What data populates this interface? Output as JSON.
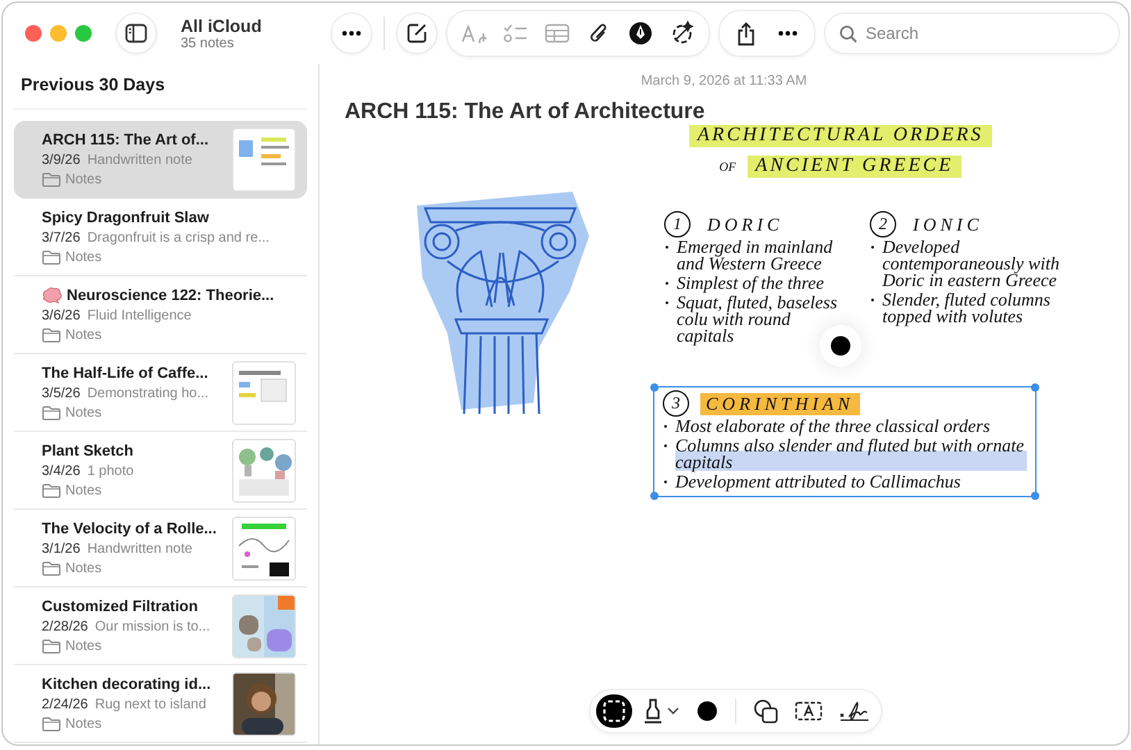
{
  "window": {
    "folder": "All iCloud",
    "note_count": "35 notes"
  },
  "search": {
    "placeholder": "Search"
  },
  "sidebar": {
    "section": "Previous 30 Days",
    "notes": [
      {
        "title": "ARCH 115: The Art of...",
        "date": "3/9/26",
        "snippet": "Handwritten note",
        "folder": "Notes",
        "kind": "thumbnail",
        "selected": true
      },
      {
        "title": "Spicy Dragonfruit Slaw",
        "date": "3/7/26",
        "snippet": "Dragonfruit is a crisp and re...",
        "folder": "Notes",
        "kind": "text",
        "selected": false
      },
      {
        "title": "Neuroscience 122: Theorie...",
        "date": "3/6/26",
        "snippet": "Fluid Intelligence",
        "folder": "Notes",
        "kind": "emoji",
        "selected": false
      },
      {
        "title": "The Half-Life of Caffe...",
        "date": "3/5/26",
        "snippet": "Demonstrating ho...",
        "folder": "Notes",
        "kind": "thumbnail",
        "selected": false
      },
      {
        "title": "Plant Sketch",
        "date": "3/4/26",
        "snippet": "1 photo",
        "folder": "Notes",
        "kind": "thumbnail",
        "selected": false
      },
      {
        "title": "The Velocity of a Rolle...",
        "date": "3/1/26",
        "snippet": "Handwritten note",
        "folder": "Notes",
        "kind": "thumbnail",
        "selected": false
      },
      {
        "title": "Customized Filtration",
        "date": "2/28/26",
        "snippet": "Our mission is to...",
        "folder": "Notes",
        "kind": "thumbnail",
        "selected": false
      },
      {
        "title": "Kitchen decorating id...",
        "date": "2/24/26",
        "snippet": "Rug next to island",
        "folder": "Notes",
        "kind": "thumbnail",
        "selected": false
      }
    ]
  },
  "note": {
    "timestamp": "March 9, 2026 at 11:33 AM",
    "title": "ARCH 115: The Art of Architecture",
    "heading": [
      "ARCHITECTURAL ORDERS",
      "ANCIENT GREECE"
    ],
    "heading_prefix": "OF",
    "orders": [
      {
        "number": "1",
        "name": "DORIC",
        "selected": false,
        "points": [
          {
            "text": "Emerged in mainland and Western Greece",
            "highlighted": false
          },
          {
            "text": "Simplest of the three",
            "highlighted": false
          },
          {
            "text": "Squat, fluted, baseless colu with round capitals",
            "highlighted": false
          }
        ]
      },
      {
        "number": "2",
        "name": "IONIC",
        "selected": false,
        "points": [
          {
            "text": "Developed contemporaneously with Doric in eastern Greece",
            "highlighted": false
          },
          {
            "text": "Slender, fluted columns topped with volutes",
            "highlighted": false
          }
        ]
      },
      {
        "number": "3",
        "name": "CORINTHIAN",
        "selected": true,
        "points": [
          {
            "text": "Most elaborate of the three classical orders",
            "highlighted": false
          },
          {
            "text": "Columns also slender and fluted but with ornate capitals",
            "highlighted": true
          },
          {
            "text": "Development attributed to Callimachus",
            "highlighted": false
          }
        ]
      }
    ]
  },
  "drawing_tools": [
    {
      "kind": "select",
      "selected": true
    },
    {
      "kind": "pen",
      "selected": false
    },
    {
      "kind": "color",
      "selected": false,
      "color": "#000000"
    },
    {
      "kind": "shapes",
      "selected": false
    },
    {
      "kind": "textbox",
      "selected": false
    },
    {
      "kind": "signature",
      "selected": false
    }
  ]
}
